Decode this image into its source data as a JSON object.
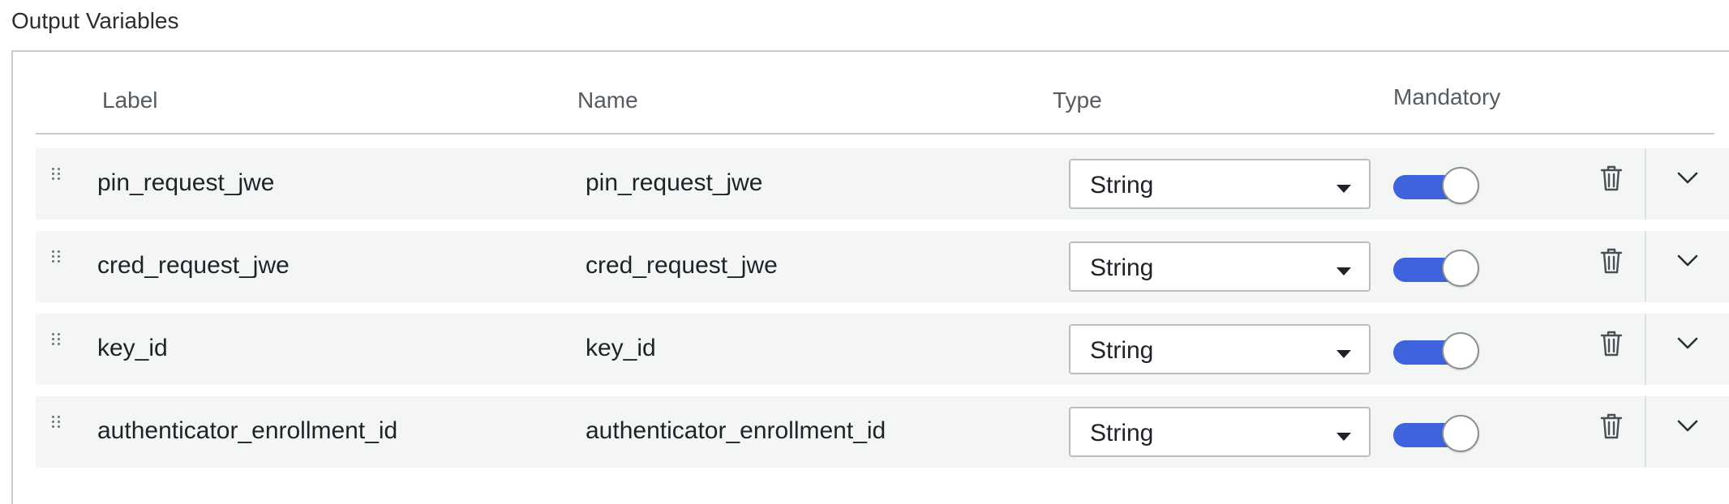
{
  "section": {
    "title": "Output Variables"
  },
  "table": {
    "headers": {
      "label": "Label",
      "name": "Name",
      "type": "Type",
      "mandatory": "Mandatory"
    },
    "rows": [
      {
        "label": "pin_request_jwe",
        "name": "pin_request_jwe",
        "type": "String",
        "mandatory": true
      },
      {
        "label": "cred_request_jwe",
        "name": "cred_request_jwe",
        "type": "String",
        "mandatory": true
      },
      {
        "label": "key_id",
        "name": "key_id",
        "type": "String",
        "mandatory": true
      },
      {
        "label": "authenticator_enrollment_id",
        "name": "authenticator_enrollment_id",
        "type": "String",
        "mandatory": true
      }
    ]
  },
  "colors": {
    "toggle_on": "#3e63dd",
    "row_bg": "#f4f5f5",
    "border": "#c8cbcd"
  },
  "icons": {
    "drag": "drag-handle-icon",
    "delete": "trash-icon",
    "expand": "chevron-down-icon",
    "dropdown": "caret-down-icon"
  }
}
